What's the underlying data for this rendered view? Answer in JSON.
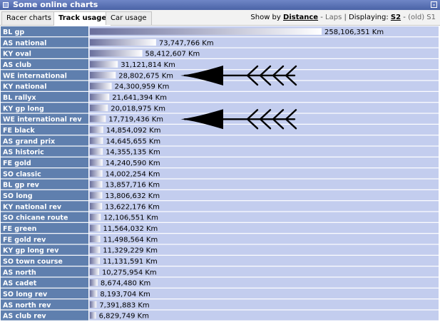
{
  "window": {
    "title": "Some online charts"
  },
  "tabs": [
    {
      "label": "Racer charts",
      "active": false
    },
    {
      "label": "Track usage",
      "active": true
    },
    {
      "label": "Car usage",
      "active": false
    }
  ],
  "controls": {
    "show_by_label": "Show by",
    "distance_label": "Distance",
    "dash1": " - ",
    "laps_label": "Laps",
    "sep": " | ",
    "displaying_label": "Displaying:",
    "s2_label": "S2",
    "dash2": " - ",
    "old_s1_label": "(old) S1"
  },
  "colors": {
    "label_bg": "#5f7fae",
    "row_bg": "#c3cdee",
    "row_gap": "#ffffff",
    "bar_dark": "#6a6f9c",
    "bar_light": "#ffffff",
    "arrow": "#000000"
  },
  "annotations": {
    "arrows": [
      {
        "pointing_at": "WE international",
        "icon": "left-arrow-icon"
      },
      {
        "pointing_at": "WE international rev",
        "icon": "left-arrow-icon"
      }
    ]
  },
  "chart_data": {
    "type": "bar",
    "orientation": "horizontal",
    "unit": "Km",
    "xlim": [
      0,
      258106351
    ],
    "categories": [
      "BL gp",
      "AS national",
      "KY oval",
      "AS club",
      "WE international",
      "KY national",
      "BL rallyx",
      "KY gp long",
      "WE international rev",
      "FE black",
      "AS grand prix",
      "AS historic",
      "FE gold",
      "SO classic",
      "BL gp rev",
      "SO long",
      "KY national rev",
      "SO chicane route",
      "FE green",
      "FE gold rev",
      "KY gp long rev",
      "SO town course",
      "AS north",
      "AS cadet",
      "SO long rev",
      "AS north rev",
      "AS club rev"
    ],
    "values": [
      258106351,
      73747766,
      58412607,
      31121814,
      28802675,
      24300959,
      21641394,
      20018975,
      17719436,
      14854092,
      14645655,
      14355135,
      14240590,
      14002254,
      13857716,
      13806632,
      13622176,
      12106551,
      11564032,
      11498564,
      11329229,
      11131591,
      10275954,
      8674480,
      8193704,
      7391883,
      6829749
    ],
    "value_labels": [
      "258,106,351 Km",
      "73,747,766 Km",
      "58,412,607 Km",
      "31,121,814 Km",
      "28,802,675 Km",
      "24,300,959 Km",
      "21,641,394 Km",
      "20,018,975 Km",
      "17,719,436 Km",
      "14,854,092 Km",
      "14,645,655 Km",
      "14,355,135 Km",
      "14,240,590 Km",
      "14,002,254 Km",
      "13,857,716 Km",
      "13,806,632 Km",
      "13,622,176 Km",
      "12,106,551 Km",
      "11,564,032 Km",
      "11,498,564 Km",
      "11,329,229 Km",
      "11,131,591 Km",
      "10,275,954 Km",
      "8,674,480 Km",
      "8,193,704 Km",
      "7,391,883 Km",
      "6,829,749 Km"
    ]
  }
}
